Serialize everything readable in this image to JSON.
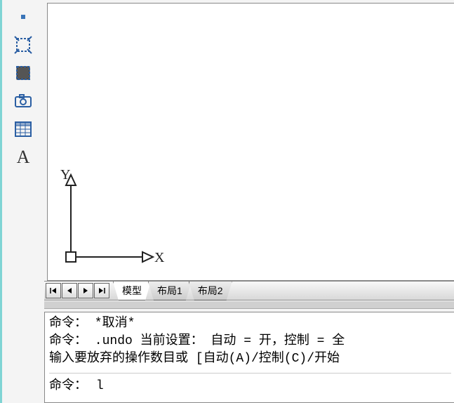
{
  "drawing": {
    "axis_x_label": "X",
    "axis_y_label": "Y"
  },
  "tabs": {
    "model": "模型",
    "layout1": "布局1",
    "layout2": "布局2"
  },
  "command": {
    "line1": "命令： *取消*",
    "line2": "命令：  .undo 当前设置： 自动 = 开，控制 = 全",
    "line3": "输入要放弃的操作数目或 [自动(A)/控制(C)/开始",
    "prompt": "命令：",
    "input_value": "l"
  }
}
